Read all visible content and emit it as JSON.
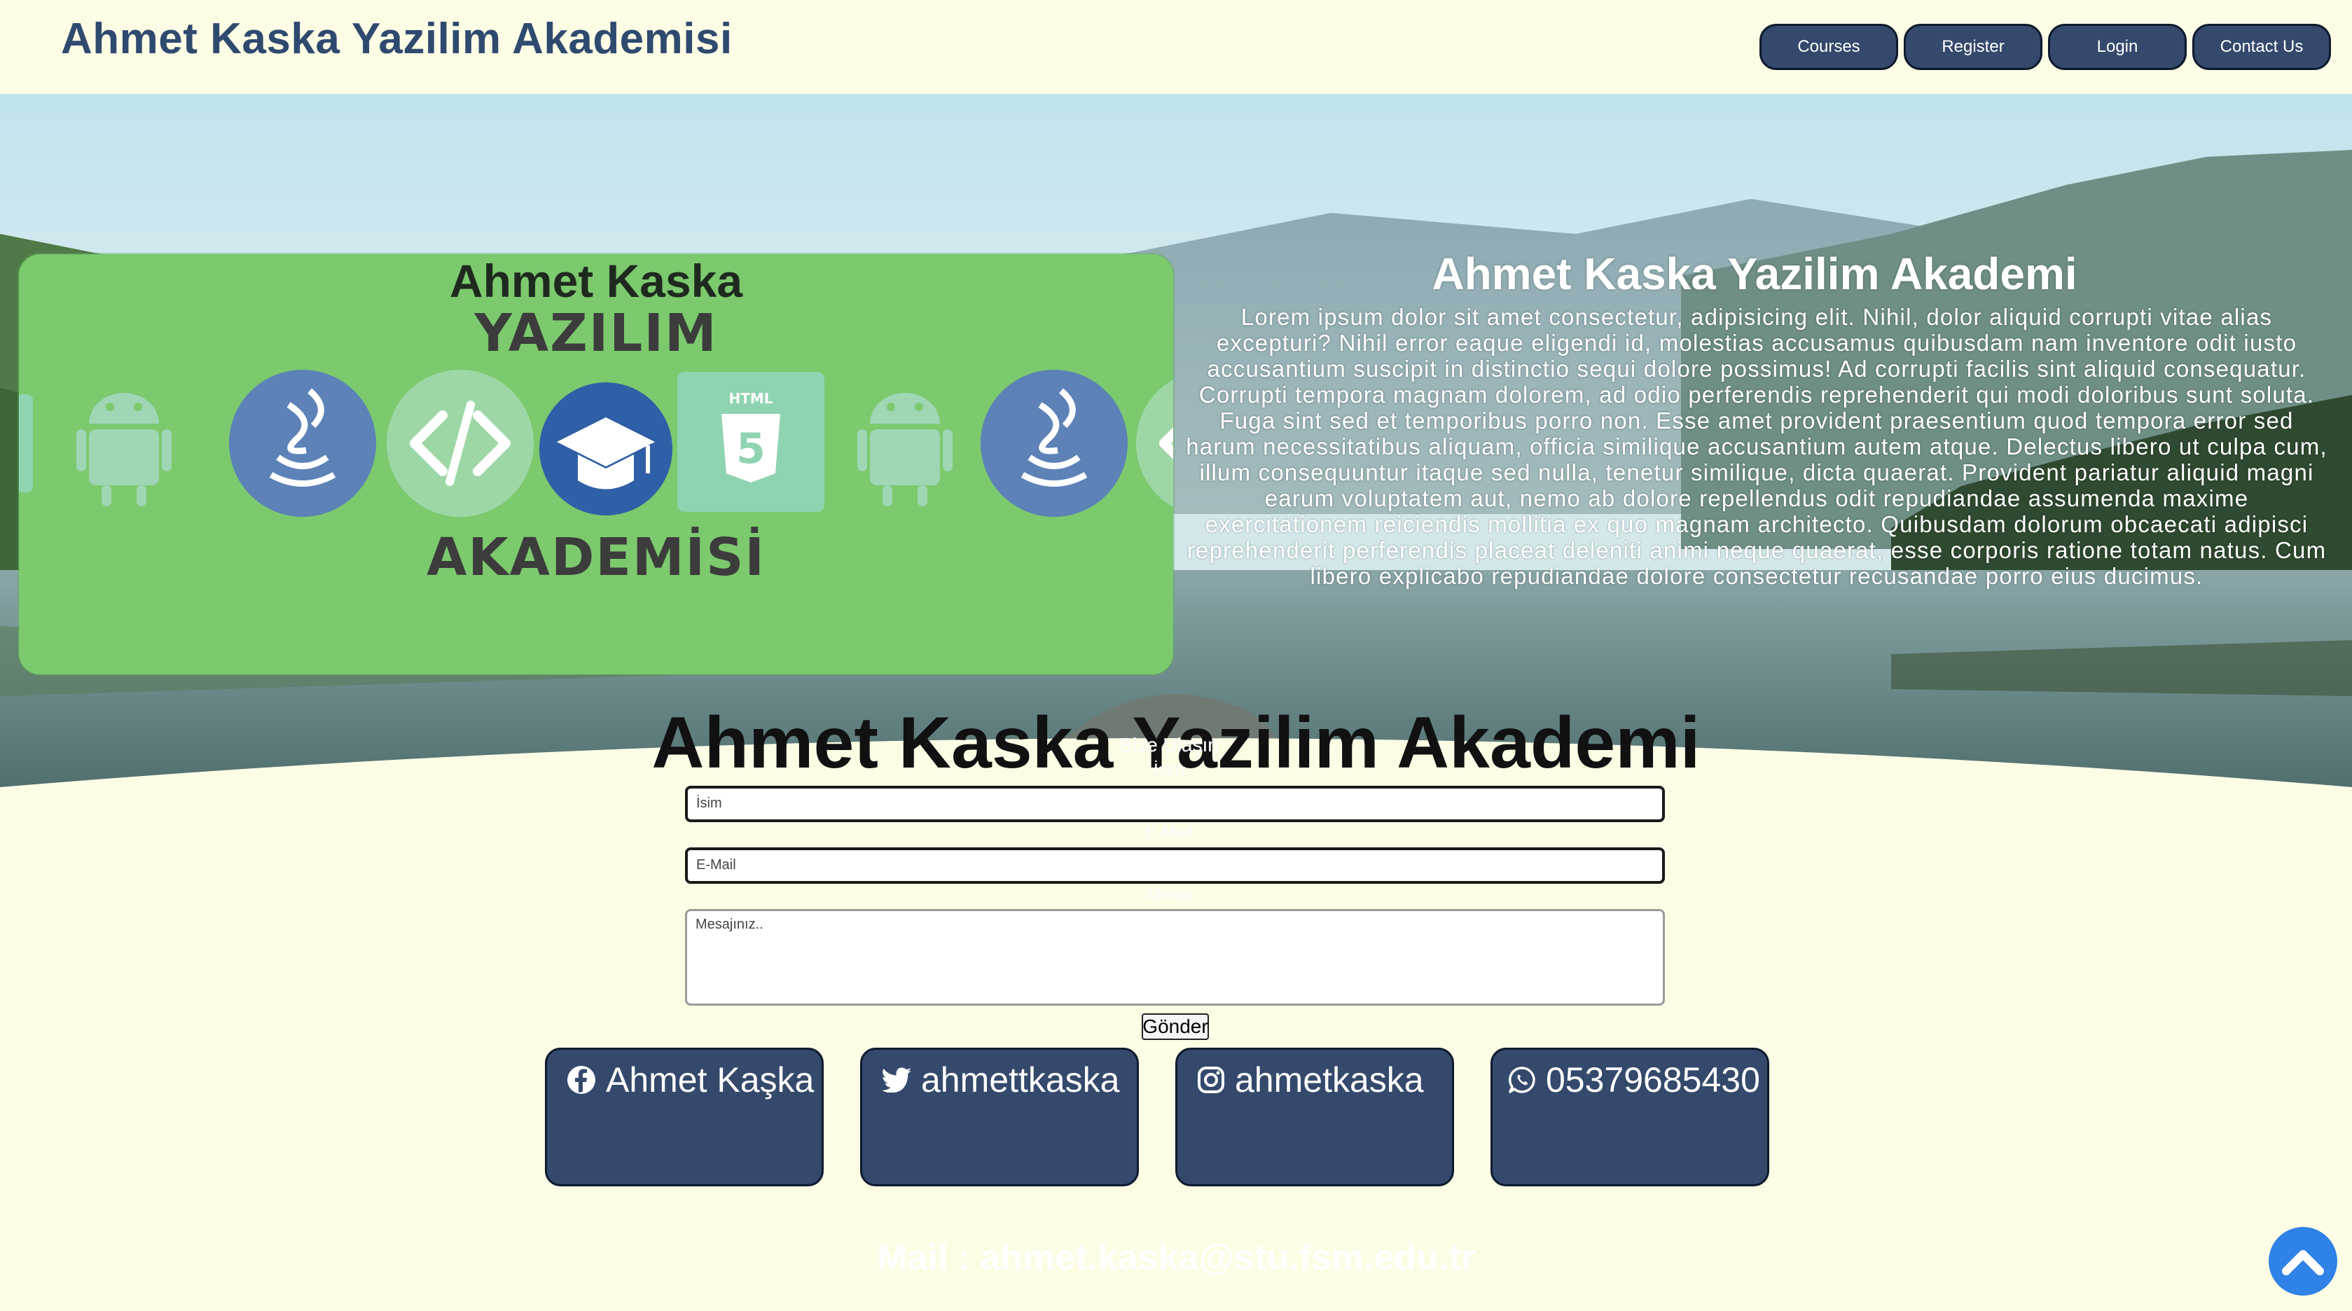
{
  "header": {
    "brand": "Ahmet Kaska Yazilim Akademisi",
    "nav": [
      "Courses",
      "Register",
      "Login",
      "Contact Us"
    ]
  },
  "banner": {
    "title_top": "Ahmet Kaska",
    "word_top": "YAZILIM",
    "word_bottom": "AKADEMİSİ",
    "html_badge": "HTML",
    "icons": [
      "html5-icon",
      "android-icon",
      "java-icon",
      "code-icon",
      "graduation-cap-icon",
      "html5-icon",
      "android-icon",
      "java-icon",
      "code-icon"
    ]
  },
  "about": {
    "title": "Ahmet Kaska Yazilim Akademi",
    "text": "Lorem ipsum dolor sit amet consectetur, adipisicing elit. Nihil, dolor aliquid corrupti vitae alias excepturi? Nihil error eaque eligendi id, molestias accusamus quibusdam nam inventore odit iusto accusantium suscipit in distinctio sequi dolore possimus! Ad corrupti facilis sint aliquid consequatur. Corrupti tempora magnam dolorem, ad odio perferendis reprehenderit qui modi doloribus sunt soluta. Fuga sint sed et temporibus porro non. Esse amet provident praesentium quod tempora error sed harum necessitatibus aliquam, officia similique accusantium autem atque. Delectus libero ut culpa cum, illum consequuntur itaque sed nulla, tenetur similique, dicta quaerat. Provident pariatur aliquid magni earum voluptatem aut, nemo ab dolore repellendus odit repudiandae assumenda maxime exercitationem reiciendis mollitia ex quo magnam architecto. Quibusdam dolorum obcaecati adipisci reprehenderit perferendis placeat deleniti animi neque quaerat, esse corporis ratione totam natus. Cum libero explicabo repudiandae dolore consectetur recusandae porro eius ducimus."
  },
  "contact": {
    "section_title": "Ahmet Kaska Yazilim Akademi",
    "form_heading": "Bize Ulaşın",
    "name_label": "İsim",
    "name_placeholder": "İsim",
    "email_label": "E-Mail",
    "email_placeholder": "E-Mail",
    "message_label": "Mesaj",
    "message_placeholder": "Mesajınız..",
    "submit": "Gönder"
  },
  "social": [
    {
      "icon": "facebook-icon",
      "label": "Ahmet Kaşka"
    },
    {
      "icon": "twitter-icon",
      "label": "ahmettkaska"
    },
    {
      "icon": "instagram-icon",
      "label": "ahmetkaska"
    },
    {
      "icon": "whatsapp-icon",
      "label": "05379685430"
    }
  ],
  "footer": {
    "mail": "Mail : ahmet.kaska@stu.fsm.edu.tr",
    "scroll_top_icon": "chevron-up-icon"
  },
  "colors": {
    "page_bg": "#fdfde6",
    "brand_text": "#2f4a6f",
    "button_bg": "#34496b",
    "banner_bg": "#7cc96e",
    "scroll_button": "#2f82e6"
  }
}
